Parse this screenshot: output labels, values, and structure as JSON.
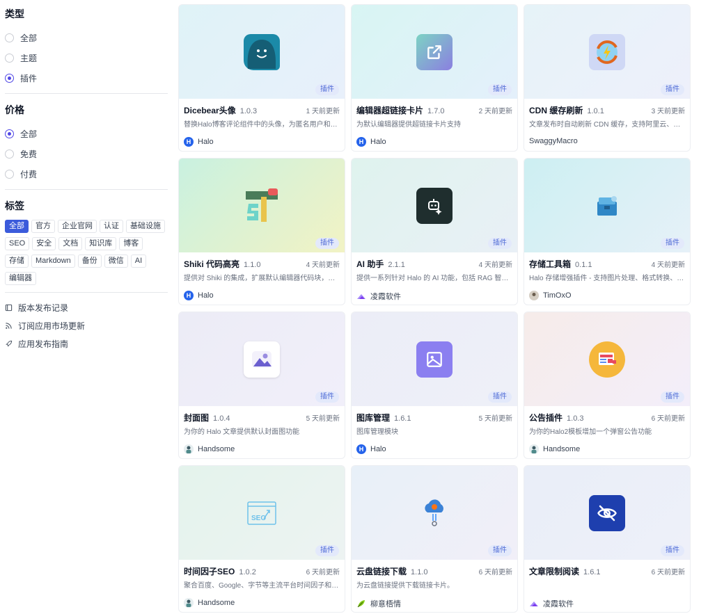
{
  "sidebar": {
    "type_title": "类型",
    "type_options": [
      "全部",
      "主题",
      "插件"
    ],
    "price_title": "价格",
    "price_options": [
      "全部",
      "免费",
      "付费"
    ],
    "tags_title": "标签",
    "tags": [
      "全部",
      "官方",
      "企业官网",
      "认证",
      "基础设施",
      "SEO",
      "安全",
      "文档",
      "知识库",
      "博客",
      "存储",
      "Markdown",
      "备份",
      "微信",
      "AI",
      "编辑器"
    ],
    "links": [
      "版本发布记录",
      "订阅应用市场更新",
      "应用发布指南"
    ]
  },
  "cards": [
    {
      "name": "Dicebear头像",
      "version": "1.0.3",
      "updated": "1 天前更新",
      "desc": "替换Halo博客评论组件中的头像，为匿名用户和未...",
      "author": "Halo",
      "badge": "插件",
      "icon": "dicebear-icon"
    },
    {
      "name": "编辑器超链接卡片",
      "version": "1.7.0",
      "updated": "2 天前更新",
      "desc": "为默认编辑器提供超链接卡片支持",
      "author": "Halo",
      "badge": "插件",
      "icon": "external-link-icon"
    },
    {
      "name": "CDN 缓存刷新",
      "version": "1.0.1",
      "updated": "3 天前更新",
      "desc": "文章发布时自动刷新 CDN 缓存，支持阿里云、腾...",
      "author": "SwaggyMacro",
      "badge": "插件",
      "icon": "refresh-icon"
    },
    {
      "name": "Shiki 代码高亮",
      "version": "1.1.0",
      "updated": "4 天前更新",
      "desc": "提供对 Shiki 的集成，扩展默认编辑器代码块，支...",
      "author": "Halo",
      "badge": "插件",
      "icon": "shiki-logo-icon"
    },
    {
      "name": "AI 助手",
      "version": "2.1.1",
      "updated": "4 天前更新",
      "desc": "提供一系列针对 Halo 的 AI 功能，包括 RAG 智能...",
      "author": "凌霞软件",
      "badge": "插件",
      "icon": "robot-icon"
    },
    {
      "name": "存储工具箱",
      "version": "0.1.1",
      "updated": "4 天前更新",
      "desc": "Halo 存储增强插件 - 支持图片处理、格式转换、水...",
      "author": "TimOxO",
      "badge": "插件",
      "icon": "toolbox-icon"
    },
    {
      "name": "封面图",
      "version": "1.0.4",
      "updated": "5 天前更新",
      "desc": "为你的 Halo 文章提供默认封面图功能",
      "author": "Handsome",
      "badge": "插件",
      "icon": "image-gallery-icon"
    },
    {
      "name": "图库管理",
      "version": "1.6.1",
      "updated": "5 天前更新",
      "desc": "图库管理模块",
      "author": "Halo",
      "badge": "插件",
      "icon": "image-icon"
    },
    {
      "name": "公告插件",
      "version": "1.0.3",
      "updated": "6 天前更新",
      "desc": "为你的Halo2模板增加一个弹窗公告功能",
      "author": "Handsome",
      "badge": "插件",
      "icon": "announcement-icon"
    },
    {
      "name": "时间因子SEO",
      "version": "1.0.2",
      "updated": "6 天前更新",
      "desc": "聚合百度、Google、字节等主流平台时间因子和元...",
      "author": "Handsome",
      "badge": "插件",
      "icon": "seo-icon"
    },
    {
      "name": "云盘链接下载",
      "version": "1.1.0",
      "updated": "6 天前更新",
      "desc": "为云盘链接提供下载链接卡片。",
      "author": "柳意梧情",
      "badge": "插件",
      "icon": "cloud-link-icon"
    },
    {
      "name": "文章限制阅读",
      "version": "1.6.1",
      "updated": "6 天前更新",
      "desc": "",
      "author": "凌霞软件",
      "badge": "插件",
      "icon": "eye-off-icon"
    }
  ]
}
